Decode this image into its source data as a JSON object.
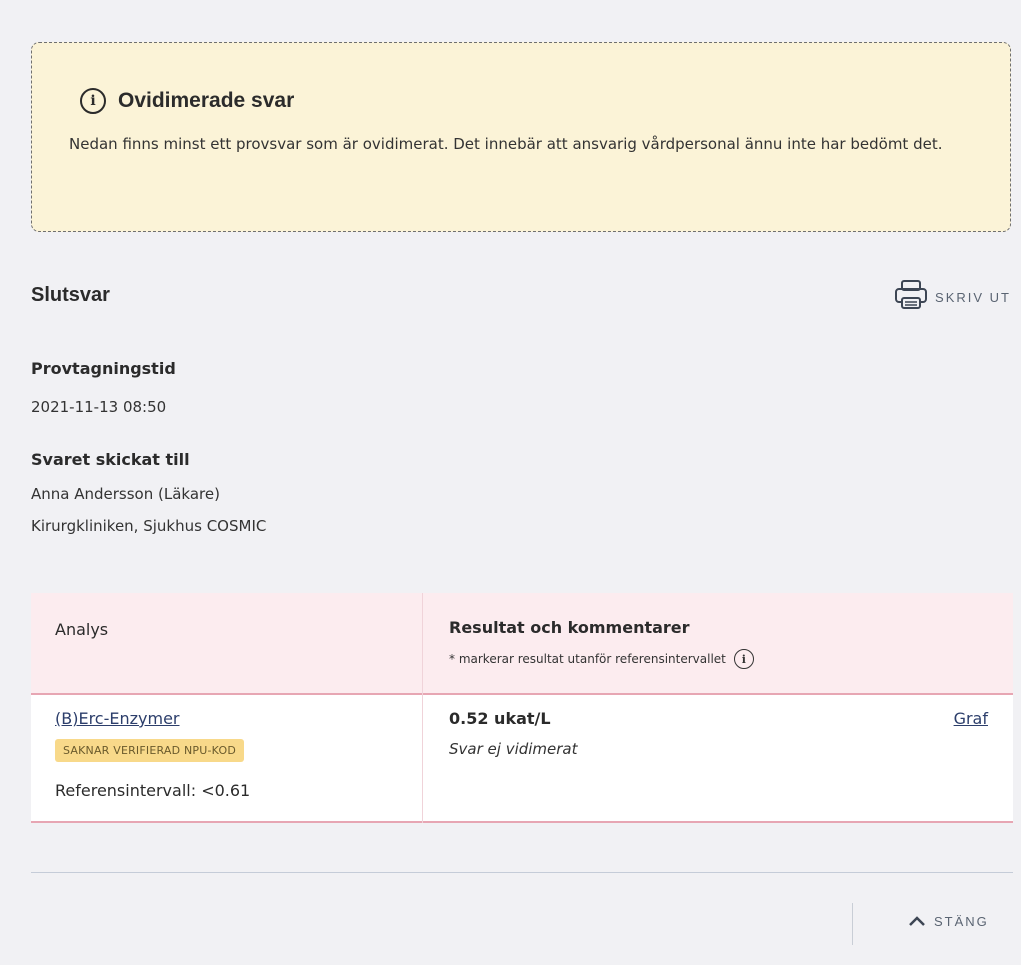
{
  "notice": {
    "icon": "info-icon",
    "info_glyph": "i",
    "title": "Ovidimerade svar",
    "body": "Nedan finns minst ett provsvar som är ovidimerat. Det innebär att ansvarig vårdpersonal ännu inte har bedömt det."
  },
  "section": {
    "title": "Slutsvar",
    "print_label": "SKRIV UT",
    "print_icon": "printer-icon"
  },
  "sampling": {
    "label": "Provtagningstid",
    "value": "2021-11-13 08:50"
  },
  "sent_to": {
    "label": "Svaret skickat till",
    "line1": "Anna Andersson (Läkare)",
    "line2": "Kirurgkliniken, Sjukhus COSMIC"
  },
  "table": {
    "col_analys": "Analys",
    "col_result": "Resultat och kommentarer",
    "note": "* markerar resultat utanför referensintervallet",
    "note_info_glyph": "i",
    "rows": [
      {
        "analys": "(B)Erc-Enzymer",
        "badge": "SAKNAR VERIFIERAD NPU-KOD",
        "reference": "Referensintervall: <0.61",
        "result": "0.52 ukat/L",
        "status": "Svar ej vidimerat",
        "graph_link": "Graf"
      }
    ]
  },
  "footer": {
    "close_label": "STÄNG",
    "close_icon": "chevron-up-icon"
  },
  "colors": {
    "notice_bg": "#fbf3d7",
    "table_header_bg": "#fcecef",
    "row_border": "#e7a6b3",
    "badge_bg": "#f8d98a",
    "link": "#2c3e6b"
  }
}
